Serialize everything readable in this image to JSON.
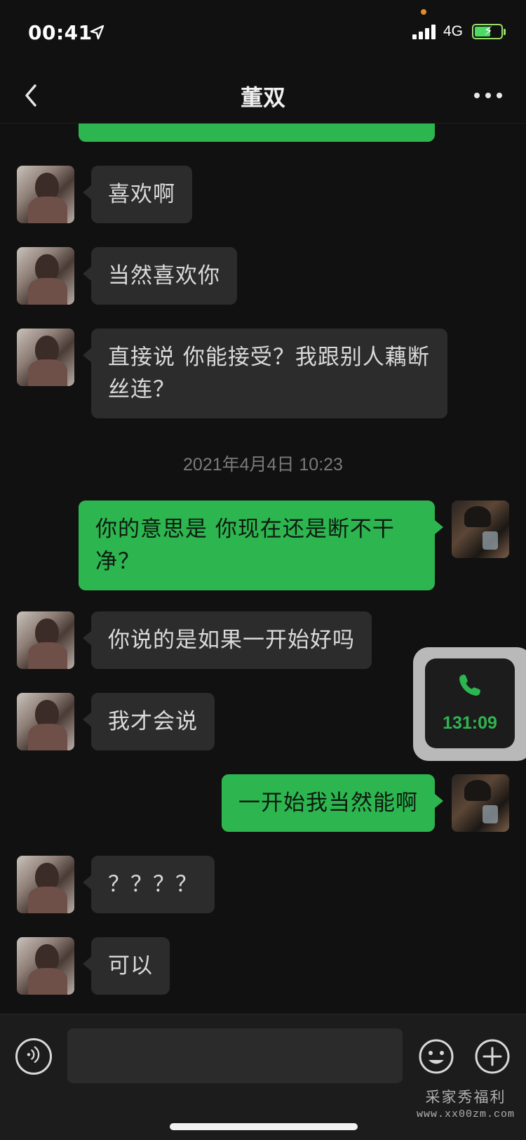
{
  "status_bar": {
    "time": "00:41",
    "network": "4G",
    "icons": [
      "location-arrow-icon",
      "signal-bars-icon",
      "battery-charging-icon"
    ]
  },
  "header": {
    "title": "董双",
    "back_icon": "chevron-left-icon",
    "more_icon": "more-dots-icon"
  },
  "messages": [
    {
      "from": "her",
      "text": "喜欢啊"
    },
    {
      "from": "her",
      "text": "当然喜欢你"
    },
    {
      "from": "her",
      "text": "直接说 你能接受？我跟别人藕断丝连？"
    },
    {
      "type": "timestamp",
      "text": "2021年4月4日 10:23"
    },
    {
      "from": "me",
      "text": "你的意思是 你现在还是断不干净？"
    },
    {
      "from": "her",
      "text": "你说的是如果一开始好吗"
    },
    {
      "from": "her",
      "text": "我才会说"
    },
    {
      "from": "me",
      "text": "一开始我当然能啊"
    },
    {
      "from": "her",
      "text": "？？？？"
    },
    {
      "from": "her",
      "text": "可以"
    }
  ],
  "call_widget": {
    "icon": "phone-icon",
    "duration": "131:09",
    "color": "#2db650"
  },
  "input_bar": {
    "voice_icon": "voice-icon",
    "emoji_icon": "emoji-icon",
    "plus_icon": "plus-icon",
    "text_value": ""
  },
  "watermark": {
    "line1": "采家秀福利",
    "line2": "www.xx00zm.com"
  },
  "colors": {
    "background": "#111111",
    "incoming_bubble": "#2c2c2c",
    "outgoing_bubble": "#2db650"
  }
}
